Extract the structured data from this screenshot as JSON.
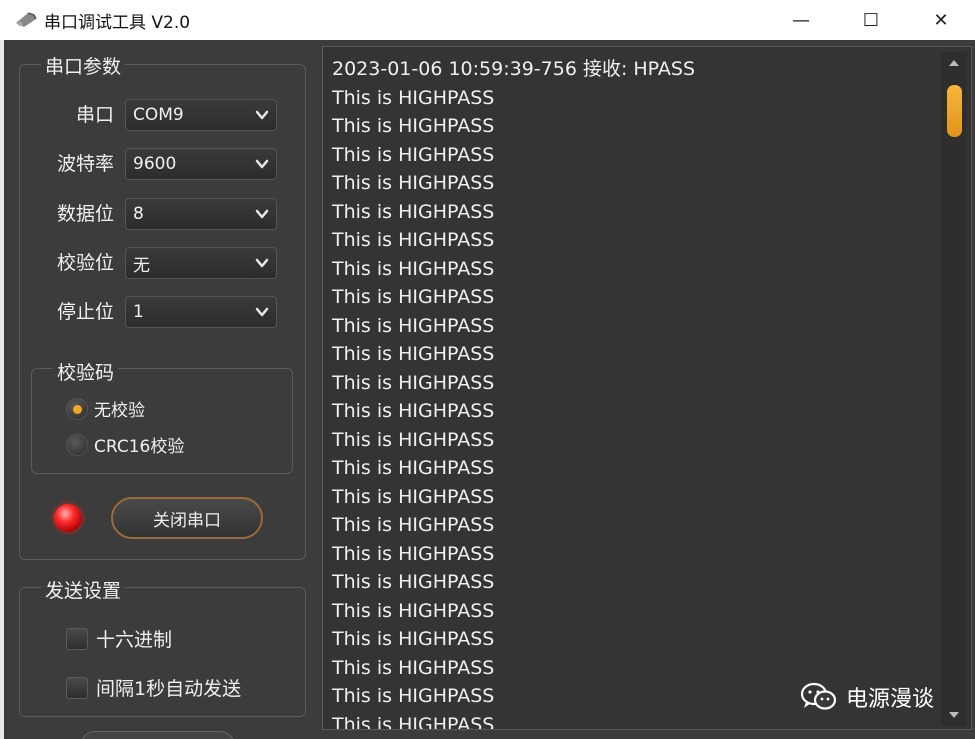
{
  "window": {
    "title": "串口调试工具 V2.0",
    "minimize_glyph": "—",
    "maximize_glyph": "☐",
    "close_glyph": "✕"
  },
  "serial_params": {
    "group_title": "串口参数",
    "fields": [
      {
        "label": "串口",
        "value": "COM9"
      },
      {
        "label": "波特率",
        "value": "9600"
      },
      {
        "label": "数据位",
        "value": "8"
      },
      {
        "label": "校验位",
        "value": "无"
      },
      {
        "label": "停止位",
        "value": "1"
      }
    ],
    "checksum": {
      "group_title": "校验码",
      "options": [
        {
          "label": "无校验",
          "selected": true
        },
        {
          "label": "CRC16校验",
          "selected": false
        }
      ]
    },
    "port_button_label": "关闭串口",
    "led_color": "#ff2a2a"
  },
  "send_settings": {
    "group_title": "发送设置",
    "options": [
      {
        "label": "十六进制",
        "checked": false
      },
      {
        "label": "间隔1秒自动发送",
        "checked": false
      }
    ]
  },
  "receive": {
    "lines": [
      "2023-01-06  10:59:39-756  接收:  HPASS",
      "This is HIGHPASS",
      "This is HIGHPASS",
      "This is HIGHPASS",
      "This is HIGHPASS",
      "This is HIGHPASS",
      "This is HIGHPASS",
      "This is HIGHPASS",
      "This is HIGHPASS",
      "This is HIGHPASS",
      "This is HIGHPASS",
      "This is HIGHPASS",
      "This is HIGHPASS",
      "This is HIGHPASS",
      "This is HIGHPASS",
      "This is HIGHPASS",
      "This is HIGHPASS",
      "This is HIGHPASS",
      "This is HIGHPASS",
      "This is HIGHPASS",
      "This is HIGHPASS",
      "This is HIGHPASS",
      "This is HIGHPASS",
      "This is HIGHPASS"
    ]
  },
  "watermark": {
    "text": "电源漫谈",
    "icon": "wechat-icon"
  },
  "colors": {
    "accent": "#f5a623",
    "scroll_thumb": "#f0a52a",
    "background": "#3c3c3c"
  }
}
